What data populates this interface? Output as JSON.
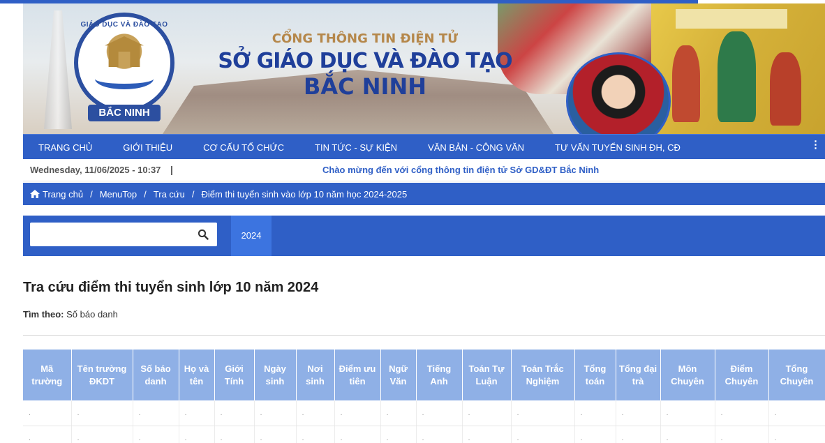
{
  "header": {
    "title_line1": "CỔNG THÔNG TIN ĐIỆN TỬ",
    "title_line2": "SỞ GIÁO DỤC VÀ ĐÀO TẠO",
    "title_line3": "BẮC NINH",
    "logo_arc_text": "GIÁO DỤC VÀ ĐÀO TẠO",
    "logo_ribbon_text": "BẮC NINH"
  },
  "nav": {
    "items": [
      {
        "label": "TRANG CHỦ"
      },
      {
        "label": "GIỚI THIỆU"
      },
      {
        "label": "CƠ CẤU TỔ CHỨC"
      },
      {
        "label": "TIN TỨC - SỰ KIỆN"
      },
      {
        "label": "VĂN BẢN - CÔNG VĂN"
      },
      {
        "label": "TƯ VẤN TUYỂN SINH ĐH, CĐ"
      }
    ],
    "more_icon": "vertical-ellipsis-icon"
  },
  "infobar": {
    "datetime": "Wednesday, 11/06/2025 - 10:37",
    "separator": "|",
    "welcome": "Chào mừng đến với cổng thông tin điện tử Sở GD&ĐT Bắc Ninh"
  },
  "breadcrumb": {
    "items": [
      "Trang chủ",
      "MenuTop",
      "Tra cứu",
      "Điểm thi tuyển sinh vào lớp 10 năm học 2024-2025"
    ],
    "separator": "/"
  },
  "search": {
    "value": "",
    "placeholder": "",
    "year_tab": "2024"
  },
  "main": {
    "title": "Tra cứu điểm thi tuyển sinh lớp 10 năm 2024",
    "find_by_label": "Tìm theo:",
    "find_by_value": "Số báo danh"
  },
  "table": {
    "headers": [
      "Mã trường",
      "Tên trường ĐKDT",
      "Số báo danh",
      "Họ và tên",
      "Giới Tính",
      "Ngày sinh",
      "Nơi sinh",
      "Điểm ưu tiên",
      "Ngữ Văn",
      "Tiếng Anh",
      "Toán Tự Luận",
      "Toán Trắc Nghiệm",
      "Tổng toán",
      "Tổng đại trà",
      "Môn Chuyên",
      "Điểm Chuyên",
      "Tổng Chuyên"
    ],
    "rows": [
      [
        ".",
        ".",
        ".",
        ".",
        ".",
        ".",
        ".",
        ".",
        ".",
        ".",
        ".",
        ".",
        ".",
        ".",
        ".",
        ".",
        "."
      ],
      [
        ".",
        ".",
        ".",
        ".",
        ".",
        ".",
        ".",
        ".",
        ".",
        ".",
        ".",
        ".",
        ".",
        ".",
        ".",
        ".",
        "."
      ]
    ]
  },
  "colors": {
    "primary": "#2f5fc6",
    "tab_active": "#3c74e0",
    "table_header": "#8fb0e6",
    "title_blue": "#1f3f9a",
    "title_gold": "#b5874a"
  }
}
